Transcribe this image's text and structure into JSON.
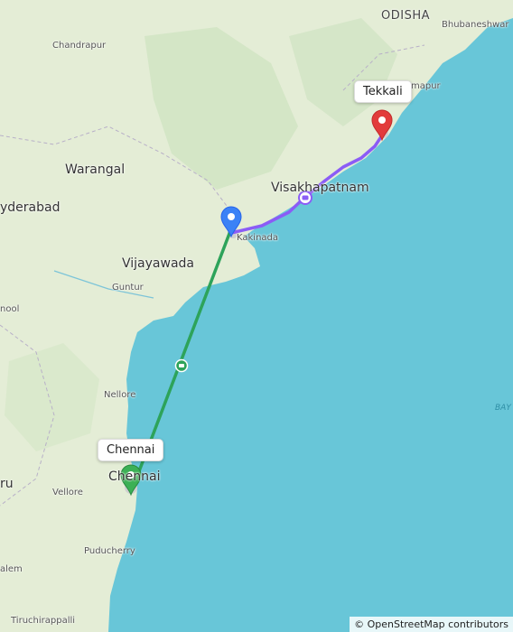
{
  "places": {
    "odisha": "ODISHA",
    "bhubaneshwar": "Bhubaneshwar",
    "chandrapur": "Chandrapur",
    "brahmapur_partial": "mapur",
    "warangal": "Warangal",
    "hyderabad": "yderabad",
    "visakhapatnam": "Visakhapatnam",
    "kakinada": "Kakinada",
    "vijayawada": "Vijayawada",
    "guntur": "Guntur",
    "kurnool_partial": "nool",
    "nellore": "Nellore",
    "bay": "BAY",
    "bengaluru_partial": "ru",
    "chennai_city": "Chennai",
    "vellore": "Vellore",
    "puducherry": "Puducherry",
    "salem_partial": "alem",
    "tiruchirappalli": "Tiruchirappalli"
  },
  "markers": {
    "start": {
      "label": "Chennai",
      "color": "#3cb055",
      "icon": "map-pin-icon"
    },
    "waypoint": {
      "color": "#3b82f6",
      "icon": "map-pin-icon"
    },
    "end": {
      "label": "Tekkali",
      "color": "#e23b3b",
      "icon": "map-pin-icon"
    }
  },
  "routes": {
    "ferry": {
      "color": "#2da35a",
      "icon": "ferry-icon"
    },
    "road": {
      "color": "#8b5cf6",
      "icon": "car-icon"
    }
  },
  "attribution": "© OpenStreetMap contributors"
}
